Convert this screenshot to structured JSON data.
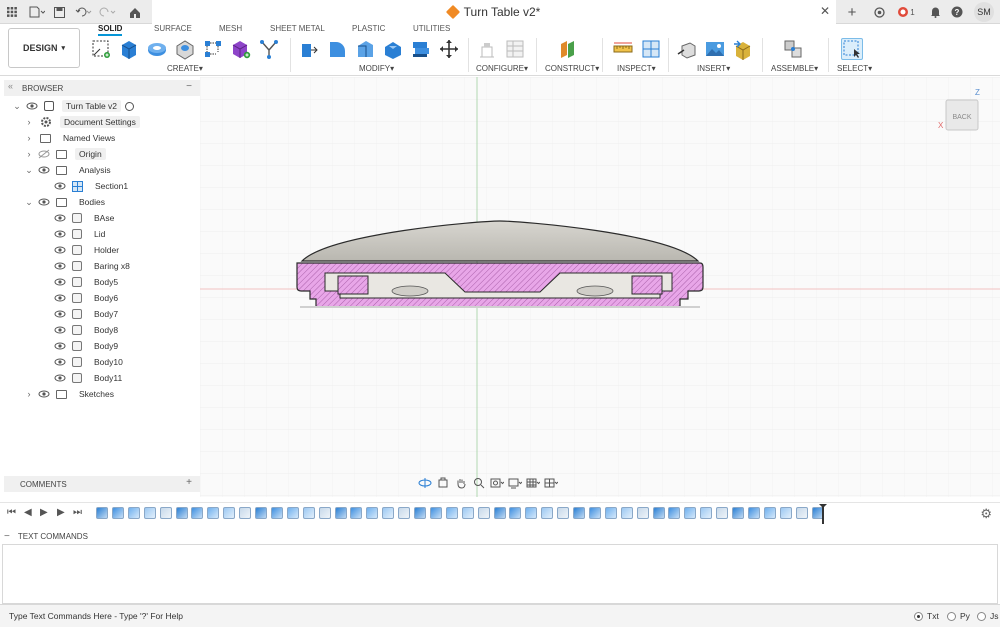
{
  "titlebar": {
    "doc_title": "Turn Table v2*",
    "close_glyph": "✕",
    "new_tab_glyph": "+",
    "avatar": "SM",
    "notifications_count": "1"
  },
  "ribbon": {
    "workspace_button": "DESIGN",
    "tabs": [
      {
        "label": "SOLID",
        "active": true
      },
      {
        "label": "SURFACE"
      },
      {
        "label": "MESH"
      },
      {
        "label": "SHEET METAL"
      },
      {
        "label": "PLASTIC"
      },
      {
        "label": "UTILITIES"
      }
    ],
    "groups": {
      "create": "CREATE",
      "modify": "MODIFY",
      "configure": "CONFIGURE",
      "construct": "CONSTRUCT",
      "inspect": "INSPECT",
      "insert": "INSERT",
      "assemble": "ASSEMBLE",
      "select": "SELECT"
    },
    "dropdown_glyph": "▾",
    "accent": "#0696d7"
  },
  "browser": {
    "title": "BROWSER",
    "collapse_glyph": "−",
    "root": "Turn Table v2",
    "items": [
      {
        "label": "Document Settings"
      },
      {
        "label": "Named Views"
      },
      {
        "label": "Origin"
      },
      {
        "label": "Analysis"
      },
      {
        "label": "Section1"
      },
      {
        "label": "Bodies"
      },
      {
        "label": "BAse"
      },
      {
        "label": "Lid"
      },
      {
        "label": "Holder"
      },
      {
        "label": "Baring x8"
      },
      {
        "label": "Body5"
      },
      {
        "label": "Body6"
      },
      {
        "label": "Body7"
      },
      {
        "label": "Body8"
      },
      {
        "label": "Body9"
      },
      {
        "label": "Body10"
      },
      {
        "label": "Body11"
      },
      {
        "label": "Sketches"
      }
    ]
  },
  "viewcube": {
    "face": "BACK",
    "axis_z": "Z",
    "axis_x": "X"
  },
  "comments": {
    "title": "COMMENTS",
    "add_glyph": "+"
  },
  "text_commands": {
    "title": "TEXT COMMANDS",
    "placeholder": "Type Text Commands Here - Type '?' For Help",
    "modes": [
      {
        "label": "Txt",
        "selected": true
      },
      {
        "label": "Py",
        "selected": false
      },
      {
        "label": "Js",
        "selected": false
      }
    ]
  },
  "colors": {
    "section_fill": "#e8a6e8",
    "lid_fill": "#cfcdc6",
    "part_outline": "#2b2b2b"
  }
}
